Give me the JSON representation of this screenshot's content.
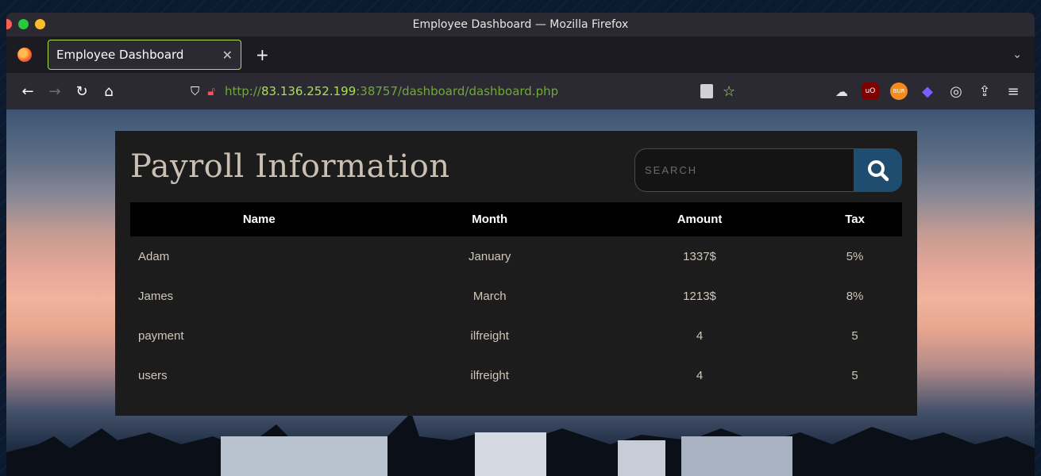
{
  "window": {
    "title": "Employee Dashboard — Mozilla Firefox"
  },
  "tabs": [
    {
      "label": "Employee Dashboard",
      "active": true
    }
  ],
  "navbar": {
    "url_protocol": "http://",
    "url_host": "83.136.252.199",
    "url_rest": ":38757/dashboard/dashboard.php"
  },
  "icons": {
    "back": "arrow-left-icon",
    "forward": "arrow-right-icon",
    "reload": "reload-icon",
    "home": "home-icon",
    "tracking": "shield-icon",
    "insecure": "insecure-lock-icon",
    "reader": "reader-view-icon",
    "bookmark": "star-icon",
    "search": "magnifier-icon",
    "extensions": [
      "extension-icon",
      "ublock-icon",
      "burp-icon",
      "diamond-icon",
      "cookie-icon",
      "share-icon",
      "menu-icon"
    ]
  },
  "colors": {
    "accent": "#a8e04d",
    "search_button": "#1f4d6f",
    "title": "#c9c0b3",
    "panel_bg": "#1c1c1c"
  },
  "page": {
    "title": "Payroll Information",
    "search_placeholder": "SEARCH",
    "table": {
      "headers": [
        "Name",
        "Month",
        "Amount",
        "Tax"
      ],
      "rows": [
        [
          "Adam",
          "January",
          "1337$",
          "5%"
        ],
        [
          "James",
          "March",
          "1213$",
          "8%"
        ],
        [
          "payment",
          "ilfreight",
          "4",
          "5"
        ],
        [
          "users",
          "ilfreight",
          "4",
          "5"
        ]
      ]
    }
  }
}
